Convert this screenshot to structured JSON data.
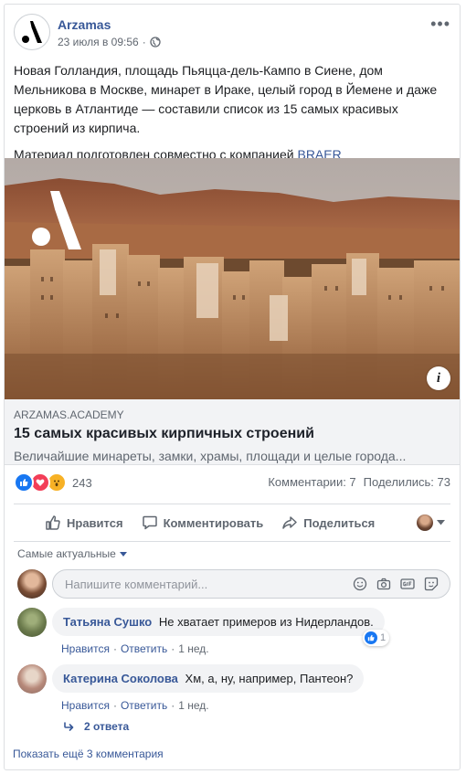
{
  "post": {
    "page_name": "Arzamas",
    "date": "23 июля в 09:56",
    "privacy_icon": "globe-icon",
    "text_main": "Новая Голландия, площадь Пьяцца-дель-Кампо в Сиене, дом Мельникова в Москве, минарет в Ираке, целый город в Йемене и даже церковь в Атлантиде — составили список из 15 самых красивых строений из кирпича.",
    "text_partner_prefix": "Материал подготовлен совместно с компанией",
    "text_partner_link": "BRAER"
  },
  "link": {
    "domain": "ARZAMAS.ACADEMY",
    "title": "15 самых красивых кирпичных строений",
    "description": "Величайшие минареты, замки, храмы, площади и целые города..."
  },
  "stats": {
    "reactions_count": "243",
    "comments": "Комментарии: 7",
    "shares": "Поделились: 73"
  },
  "actions": {
    "like": "Нравится",
    "comment": "Комментировать",
    "share": "Поделиться"
  },
  "comments_section": {
    "sort_label": "Самые актуальные",
    "input_placeholder": "Напишите комментарий...",
    "comments": [
      {
        "author": "Татьяна Сушко",
        "text": "Не хватает примеров из Нидерландов.",
        "like": "Нравится",
        "reply": "Ответить",
        "time": "1 нед.",
        "reactions": "1"
      },
      {
        "author": "Катерина Соколова",
        "text": "Хм, а, ну, например, Пантеон?",
        "like": "Нравится",
        "reply": "Ответить",
        "time": "1 нед."
      }
    ],
    "replies_label": "2 ответа",
    "show_more": "Показать ещё 3 комментария"
  },
  "colors": {
    "link_blue": "#385898",
    "like_blue": "#1877f2",
    "love_red": "#f33e58",
    "wow_yellow": "#f7b125"
  }
}
